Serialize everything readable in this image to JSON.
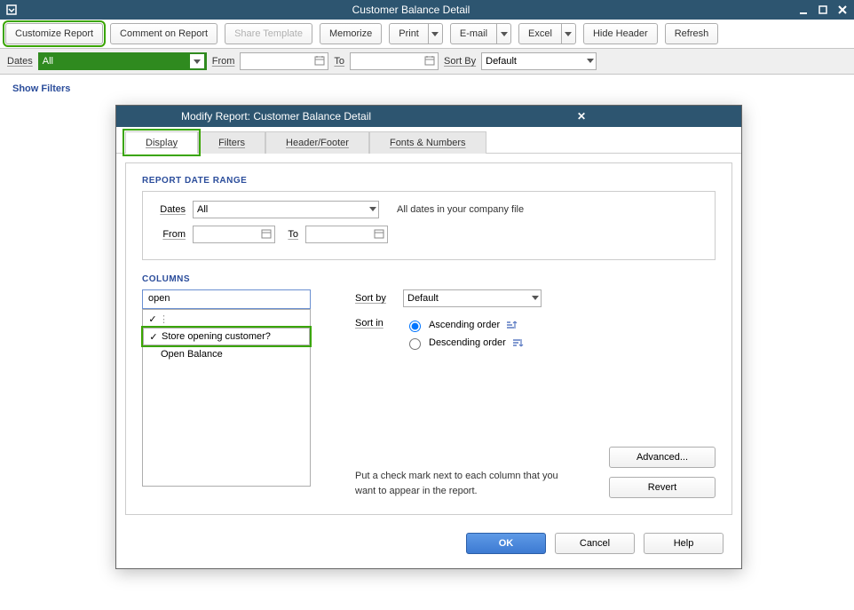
{
  "window": {
    "title": "Customer Balance Detail"
  },
  "toolbar": {
    "customize": "Customize Report",
    "comment": "Comment on Report",
    "share": "Share Template",
    "memorize": "Memorize",
    "print": "Print",
    "email": "E-mail",
    "excel": "Excel",
    "hide_header": "Hide Header",
    "refresh": "Refresh"
  },
  "filterbar": {
    "dates_label": "Dates",
    "dates_value": "All",
    "from_label": "From",
    "from_value": "",
    "to_label": "To",
    "to_value": "",
    "sortby_label": "Sort By",
    "sortby_value": "Default"
  },
  "show_filters": "Show Filters",
  "dialog": {
    "title": "Modify Report: Customer Balance Detail",
    "tabs": {
      "display": "Display",
      "filters": "Filters",
      "header_footer": "Header/Footer",
      "fonts": "Fonts & Numbers"
    },
    "report_date_range": {
      "section": "REPORT DATE RANGE",
      "dates_label": "Dates",
      "dates_value": "All",
      "dates_hint": "All dates in your company file",
      "from_label": "From",
      "from_value": "",
      "to_label": "To",
      "to_value": ""
    },
    "columns": {
      "section": "COLUMNS",
      "search_value": "open",
      "items": [
        {
          "checked": true,
          "label": ""
        },
        {
          "checked": true,
          "label": "Store opening customer?"
        },
        {
          "checked": false,
          "label": "Open Balance"
        }
      ],
      "sort_by_label": "Sort by",
      "sort_by_value": "Default",
      "sort_in_label": "Sort in",
      "asc_label": "Ascending order",
      "desc_label": "Descending order",
      "help_text": "Put a check mark next to each column that you want to appear in the report.",
      "advanced": "Advanced...",
      "revert": "Revert"
    },
    "buttons": {
      "ok": "OK",
      "cancel": "Cancel",
      "help": "Help"
    }
  }
}
